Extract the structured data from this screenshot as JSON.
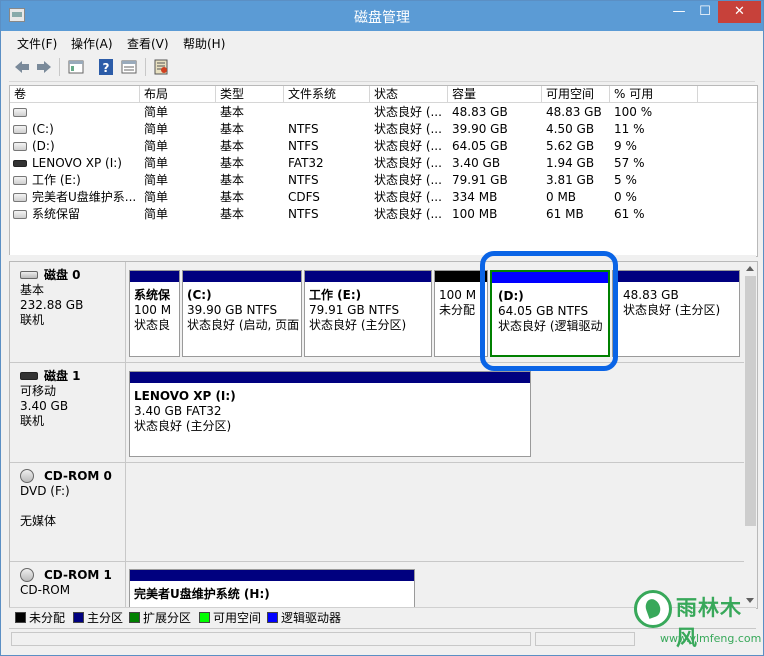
{
  "window": {
    "title": "磁盘管理"
  },
  "menu": [
    "文件(F)",
    "操作(A)",
    "查看(V)",
    "帮助(H)"
  ],
  "table": {
    "headers": [
      "卷",
      "布局",
      "类型",
      "文件系统",
      "状态",
      "容量",
      "可用空间",
      "% 可用"
    ],
    "rows": [
      {
        "icon": "drive-icon",
        "vol": "",
        "layout": "简单",
        "type": "基本",
        "fs": "",
        "status": "状态良好 (...",
        "capacity": "48.83 GB",
        "free": "48.83 GB",
        "pct": "100 %"
      },
      {
        "icon": "drive-icon",
        "vol": "(C:)",
        "layout": "简单",
        "type": "基本",
        "fs": "NTFS",
        "status": "状态良好 (...",
        "capacity": "39.90 GB",
        "free": "4.50 GB",
        "pct": "11 %"
      },
      {
        "icon": "drive-icon",
        "vol": "(D:)",
        "layout": "简单",
        "type": "基本",
        "fs": "NTFS",
        "status": "状态良好 (...",
        "capacity": "64.05 GB",
        "free": "5.62 GB",
        "pct": "9 %"
      },
      {
        "icon": "usb-drive-icon",
        "vol": "LENOVO XP (I:)",
        "layout": "简单",
        "type": "基本",
        "fs": "FAT32",
        "status": "状态良好 (...",
        "capacity": "3.40 GB",
        "free": "1.94 GB",
        "pct": "57 %"
      },
      {
        "icon": "drive-icon",
        "vol": "工作 (E:)",
        "layout": "简单",
        "type": "基本",
        "fs": "NTFS",
        "status": "状态良好 (...",
        "capacity": "79.91 GB",
        "free": "3.81 GB",
        "pct": "5 %"
      },
      {
        "icon": "cd-drive-icon",
        "vol": "完美者U盘维护系...",
        "layout": "简单",
        "type": "基本",
        "fs": "CDFS",
        "status": "状态良好 (...",
        "capacity": "334 MB",
        "free": "0 MB",
        "pct": "0 %"
      },
      {
        "icon": "drive-icon",
        "vol": "系统保留",
        "layout": "简单",
        "type": "基本",
        "fs": "NTFS",
        "status": "状态良好 (...",
        "capacity": "100 MB",
        "free": "61 MB",
        "pct": "61 %"
      }
    ]
  },
  "disks": {
    "disk0": {
      "name": "磁盘 0",
      "line1": "基本",
      "line2": "232.88 GB",
      "line3": "联机",
      "parts": [
        {
          "name": "系统保",
          "l2": "100 M",
          "l3": "状态良"
        },
        {
          "name": "(C:)",
          "l2": "39.90 GB NTFS",
          "l3": "状态良好 (启动, 页面"
        },
        {
          "name": "工作  (E:)",
          "l2": "79.91 GB NTFS",
          "l3": "状态良好 (主分区)"
        },
        {
          "name": "",
          "l2": "100 M",
          "l3": "未分配"
        },
        {
          "name": "(D:)",
          "l2": "64.05 GB NTFS",
          "l3": "状态良好 (逻辑驱动"
        },
        {
          "name": "",
          "l2": "48.83 GB",
          "l3": "状态良好 (主分区)"
        }
      ]
    },
    "disk1": {
      "name": "磁盘 1",
      "line1": "可移动",
      "line2": "3.40 GB",
      "line3": "联机",
      "parts": [
        {
          "name": "LENOVO XP  (I:)",
          "l2": "3.40 GB FAT32",
          "l3": "状态良好 (主分区)"
        }
      ]
    },
    "cdrom0": {
      "name": "CD-ROM 0",
      "line1": "DVD (F:)",
      "line2": "",
      "line3": "无媒体"
    },
    "cdrom1": {
      "name": "CD-ROM 1",
      "line1": "CD-ROM",
      "parts": [
        {
          "name": "完美者U盘维护系统  (H:)"
        }
      ]
    }
  },
  "legend": [
    {
      "label": "未分配",
      "color": "#000000"
    },
    {
      "label": "主分区",
      "color": "#00007f"
    },
    {
      "label": "扩展分区",
      "color": "#008000"
    },
    {
      "label": "可用空间",
      "color": "#00ff00"
    },
    {
      "label": "逻辑驱动器",
      "color": "#0000ff"
    }
  ],
  "watermark": {
    "brand": "雨林木风",
    "url": "www.ylmfeng.com"
  },
  "colors": {
    "titlebar": "#5b9bd5",
    "primary": "#00007f",
    "logical": "#0000ff",
    "highlight": "#0a64e6"
  }
}
